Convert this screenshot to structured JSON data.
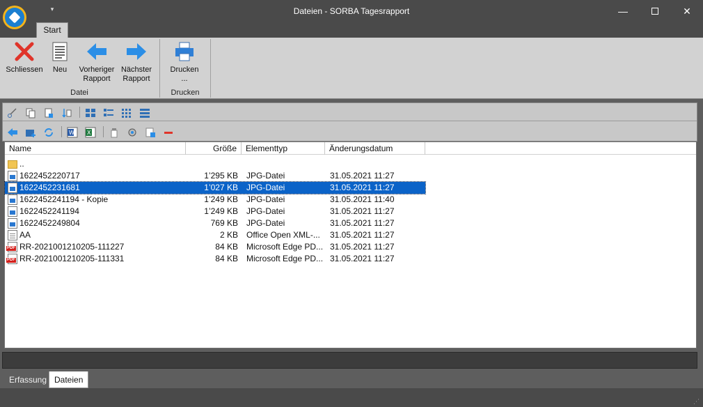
{
  "window": {
    "title": "Dateien - SORBA Tagesrapport",
    "minimize_icon": "minimize-icon",
    "maximize_icon": "maximize-icon",
    "close_icon": "close-icon"
  },
  "ribbon": {
    "tab": "Start",
    "groups": [
      {
        "label": "Datei",
        "buttons": [
          {
            "id": "schliessen",
            "label": "Schliessen",
            "icon": "red-x-icon"
          },
          {
            "id": "neu",
            "label": "Neu",
            "icon": "document-icon"
          },
          {
            "id": "vorheriger",
            "label": "Vorheriger Rapport",
            "icon": "arrow-left-icon"
          },
          {
            "id": "naechster",
            "label": "Nächster Rapport",
            "icon": "arrow-right-icon"
          }
        ]
      },
      {
        "label": "Drucken",
        "buttons": [
          {
            "id": "drucken",
            "label": "Drucken ...",
            "icon": "printer-icon"
          }
        ]
      }
    ]
  },
  "toolbar": {
    "row1": [
      "cut-icon",
      "copy-icon",
      "paste-icon",
      "move-icon",
      "view-large-icons-icon",
      "view-list-icon",
      "view-small-icons-icon",
      "view-details-icon"
    ],
    "row2": [
      "back-icon",
      "new-folder-icon",
      "refresh-icon",
      "word-icon",
      "excel-icon",
      "properties-icon",
      "settings-icon",
      "rename-icon",
      "delete-icon"
    ]
  },
  "file_list": {
    "columns": [
      "Name",
      "Größe",
      "Elementtyp",
      "Änderungsdatum"
    ],
    "rows": [
      {
        "name": "..",
        "size": "",
        "type": "",
        "date": "",
        "icon": "folder-up-icon",
        "selected": false
      },
      {
        "name": "1622452220717",
        "size": "1’295 KB",
        "type": "JPG-Datei",
        "date": "31.05.2021 11:27",
        "icon": "image-file-icon",
        "selected": false
      },
      {
        "name": "1622452231681",
        "size": "1’027 KB",
        "type": "JPG-Datei",
        "date": "31.05.2021 11:27",
        "icon": "image-file-icon",
        "selected": true
      },
      {
        "name": "1622452241194 - Kopie",
        "size": "1’249 KB",
        "type": "JPG-Datei",
        "date": "31.05.2021 11:40",
        "icon": "image-file-icon",
        "selected": false
      },
      {
        "name": "1622452241194",
        "size": "1’249 KB",
        "type": "JPG-Datei",
        "date": "31.05.2021 11:27",
        "icon": "image-file-icon",
        "selected": false
      },
      {
        "name": "1622452249804",
        "size": "769 KB",
        "type": "JPG-Datei",
        "date": "31.05.2021 11:27",
        "icon": "image-file-icon",
        "selected": false
      },
      {
        "name": "AA",
        "size": "2 KB",
        "type": "Office Open XML-...",
        "date": "31.05.2021 11:27",
        "icon": "document-file-icon",
        "selected": false
      },
      {
        "name": "RR-2021001210205-111227",
        "size": "84 KB",
        "type": "Microsoft Edge PD...",
        "date": "31.05.2021 11:27",
        "icon": "pdf-file-icon",
        "selected": false
      },
      {
        "name": "RR-2021001210205-111331",
        "size": "84 KB",
        "type": "Microsoft Edge PD...",
        "date": "31.05.2021 11:27",
        "icon": "pdf-file-icon",
        "selected": false
      }
    ]
  },
  "bottom_tabs": {
    "erfassung": "Erfassung",
    "dateien": "Dateien"
  },
  "colors": {
    "selection": "#0b63c8",
    "ribbon_bg": "#d2d2d2",
    "titlebar_bg": "#4a4a4a"
  }
}
